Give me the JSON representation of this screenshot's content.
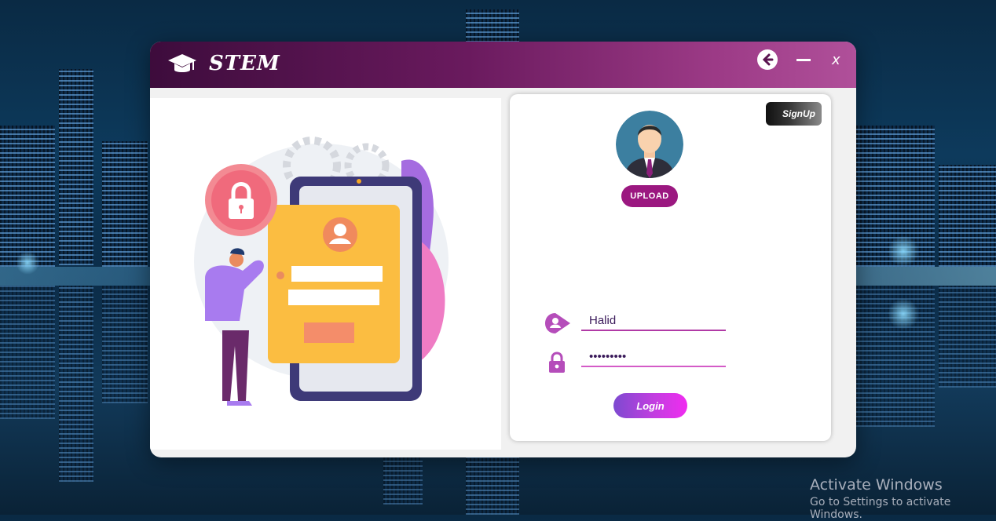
{
  "window": {
    "title": "STEM",
    "back_icon": "arrow-left-circle-icon",
    "minimize_icon": "minimize-icon",
    "close_label": "x"
  },
  "illustration": {
    "icon": "mobile-login-illustration",
    "lock_icon": "padlock-icon"
  },
  "login_panel": {
    "signup_label": "SignUp",
    "upload_label": "UPLOAD",
    "username": {
      "value": "Halid",
      "icon": "user-icon"
    },
    "password": {
      "value": "•••••••••",
      "icon": "lock-icon"
    },
    "login_label": "Login"
  },
  "watermark": {
    "line1": "Activate Windows",
    "line2": "Go to Settings to activate Windows."
  },
  "colors": {
    "titlebar_start": "#3d0c3c",
    "titlebar_end": "#b0509a",
    "accent": "#b13aa6",
    "login_gradient_end": "#f02cf0"
  }
}
